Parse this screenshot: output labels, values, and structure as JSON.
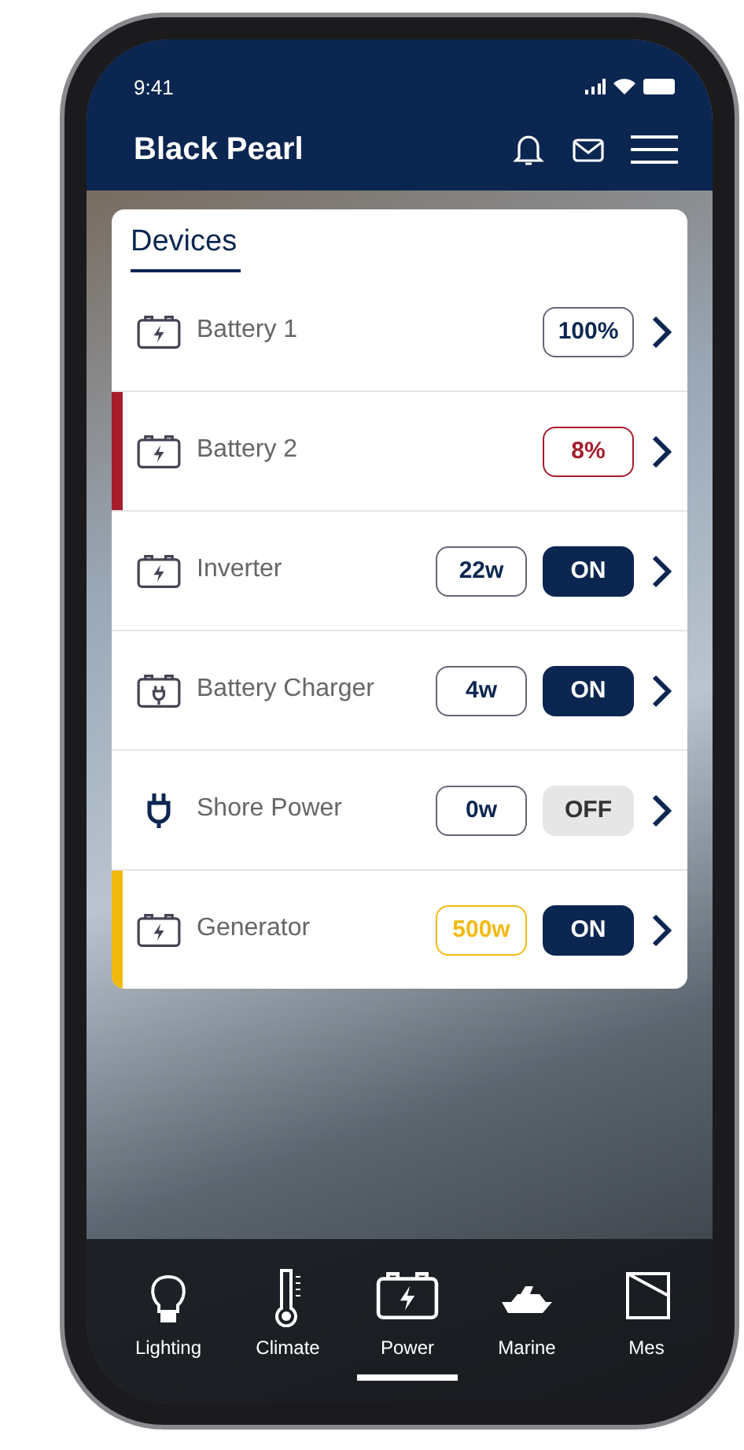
{
  "status_bar": {
    "time": "9:41"
  },
  "header": {
    "title": "Black Pearl"
  },
  "card": {
    "title": "Devices"
  },
  "devices": [
    {
      "kind": "battery",
      "name": "Battery 1",
      "reading": "100%"
    },
    {
      "kind": "battery",
      "name": "Battery 2",
      "reading": "8%",
      "color": "#a51c2c"
    },
    {
      "kind": "battery",
      "name": "Inverter",
      "reading": "22w",
      "switch": {
        "label": "ON",
        "on": true
      }
    },
    {
      "kind": "charger",
      "name": "Battery Charger",
      "reading": "4w",
      "switch": {
        "label": "ON",
        "on": true
      }
    },
    {
      "kind": "plug",
      "name": "Shore Power",
      "reading": "0w",
      "switch": {
        "label": "OFF",
        "on": false
      }
    },
    {
      "kind": "battery",
      "name": "Generator",
      "reading": "500w",
      "color": "#f2b90f",
      "switch": {
        "label": "ON",
        "on": true
      }
    }
  ],
  "tabs": [
    {
      "kind": "bulb",
      "label": "Lighting",
      "selected": false
    },
    {
      "kind": "thermometer",
      "label": "Climate",
      "selected": false
    },
    {
      "kind": "battery",
      "label": "Power",
      "selected": true
    },
    {
      "kind": "yacht",
      "label": "Marine",
      "selected": false
    },
    {
      "kind": "message",
      "label": "Mes",
      "selected": false
    }
  ]
}
